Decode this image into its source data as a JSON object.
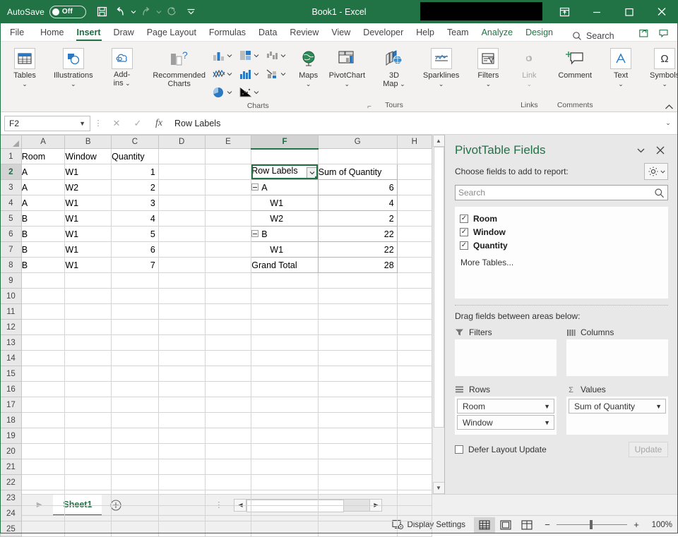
{
  "titlebar": {
    "autosave_label": "AutoSave",
    "autosave_state": "Off",
    "save_icon": "save-icon",
    "undo_icon": "undo-icon",
    "redo_icon": "redo-icon",
    "refresh_icon": "refresh-icon",
    "customize_icon": "customize-quick-access-toolbar-icon",
    "document_title": "Book1  -  Excel",
    "ribbon_display_icon": "ribbon-display-options-icon",
    "minimize_icon": "minimize-icon",
    "maximize_icon": "maximize-icon",
    "close_icon": "close-icon"
  },
  "ribbon_tabs": {
    "items": [
      {
        "label": "File",
        "state": "normal"
      },
      {
        "label": "Home",
        "state": "normal"
      },
      {
        "label": "Insert",
        "state": "active"
      },
      {
        "label": "Draw",
        "state": "normal"
      },
      {
        "label": "Page Layout",
        "state": "normal"
      },
      {
        "label": "Formulas",
        "state": "normal"
      },
      {
        "label": "Data",
        "state": "normal"
      },
      {
        "label": "Review",
        "state": "normal"
      },
      {
        "label": "View",
        "state": "normal"
      },
      {
        "label": "Developer",
        "state": "normal"
      },
      {
        "label": "Help",
        "state": "normal"
      },
      {
        "label": "Team",
        "state": "normal"
      },
      {
        "label": "Analyze",
        "state": "contextual"
      },
      {
        "label": "Design",
        "state": "contextual"
      }
    ],
    "search_label": "Search",
    "share_icon": "share-icon",
    "comments_icon": "comments-icon"
  },
  "ribbon": {
    "groups": [
      {
        "label": "",
        "buttons": [
          {
            "label": "Tables",
            "icon": "tables-icon",
            "chevron": true
          }
        ]
      },
      {
        "label": "",
        "buttons": [
          {
            "label": "Illustrations",
            "icon": "illustrations-icon",
            "chevron": true
          }
        ]
      },
      {
        "label": "",
        "buttons": [
          {
            "label": "Add-ins",
            "icon": "add-ins-icon",
            "chevron": true
          }
        ]
      },
      {
        "label": "Charts",
        "buttons": [
          {
            "label": "Recommended Charts",
            "icon": "recommended-charts-icon",
            "chevron": false
          }
        ]
      },
      {
        "label": "Tours",
        "buttons": [
          {
            "label": "3D Map",
            "icon": "3d-map-icon",
            "chevron": true
          }
        ]
      },
      {
        "label": "",
        "buttons": [
          {
            "label": "Sparklines",
            "icon": "sparklines-icon",
            "chevron": true
          }
        ]
      },
      {
        "label": "",
        "buttons": [
          {
            "label": "Filters",
            "icon": "filters-icon",
            "chevron": true
          }
        ]
      },
      {
        "label": "Links",
        "buttons": [
          {
            "label": "Link",
            "icon": "link-icon",
            "chevron": true
          }
        ]
      },
      {
        "label": "Comments",
        "buttons": [
          {
            "label": "Comment",
            "icon": "comment-icon",
            "chevron": false
          }
        ]
      },
      {
        "label": "",
        "buttons": [
          {
            "label": "Text",
            "icon": "text-icon",
            "chevron": true
          }
        ]
      },
      {
        "label": "",
        "buttons": [
          {
            "label": "Symbols",
            "icon": "symbols-icon",
            "chevron": true
          }
        ]
      }
    ],
    "maps_label": "Maps",
    "pivotchart_label": "PivotChart",
    "recommended_charts_label_l1": "Recommended",
    "recommended_charts_label_l2": "Charts",
    "map3d_label_l1": "3D",
    "map3d_label_l2": "Map",
    "sparklines_label": "Sparklines",
    "filters_label": "Filters",
    "link_label": "Link",
    "comment_label": "Comment",
    "text_label": "Text",
    "symbols_label": "Symbols",
    "tables_label": "Tables",
    "illustrations_label": "Illustrations",
    "addins_label_l1": "Add-",
    "addins_label_l2": "ins",
    "group_charts": "Charts",
    "group_tours": "Tours",
    "group_links": "Links",
    "group_comments": "Comments",
    "collapse_icon": "collapse-ribbon-icon"
  },
  "formula_bar": {
    "name_box_value": "F2",
    "cancel_icon": "cancel-icon",
    "enter_icon": "enter-icon",
    "function_icon": "insert-function-icon",
    "formula_value": "Row Labels",
    "expand_icon": "expand-formula-bar-icon"
  },
  "grid": {
    "columns": [
      "A",
      "B",
      "C",
      "D",
      "E",
      "F",
      "G",
      "H"
    ],
    "selected_column": "F",
    "selected_row": "2",
    "rows": [
      "1",
      "2",
      "3",
      "4",
      "5",
      "6",
      "7",
      "8",
      "9",
      "10",
      "11",
      "12",
      "13",
      "14",
      "15",
      "16",
      "17",
      "18",
      "19",
      "20",
      "21",
      "22",
      "23",
      "24",
      "25"
    ],
    "source_table": {
      "headers": [
        "Room",
        "Window",
        "Quantity"
      ],
      "rows": [
        [
          "A",
          "W1",
          "1"
        ],
        [
          "A",
          "W2",
          "2"
        ],
        [
          "A",
          "W1",
          "3"
        ],
        [
          "B",
          "W1",
          "4"
        ],
        [
          "B",
          "W1",
          "5"
        ],
        [
          "B",
          "W1",
          "6"
        ],
        [
          "B",
          "W1",
          "7"
        ]
      ]
    },
    "pivot_table": {
      "header_row_labels": "Row Labels",
      "header_values": "Sum of Quantity",
      "filter_icon": "filter-dropdown-icon",
      "rows": [
        {
          "label": "A",
          "value": "6",
          "level": 0,
          "expandable": true
        },
        {
          "label": "W1",
          "value": "4",
          "level": 1,
          "expandable": false
        },
        {
          "label": "W2",
          "value": "2",
          "level": 1,
          "expandable": false
        },
        {
          "label": "B",
          "value": "22",
          "level": 0,
          "expandable": true
        },
        {
          "label": "W1",
          "value": "22",
          "level": 1,
          "expandable": false
        },
        {
          "label": "Grand Total",
          "value": "28",
          "level": 0,
          "expandable": false
        }
      ]
    }
  },
  "pivot_pane": {
    "title": "PivotTable Fields",
    "dropdown_icon": "pane-options-icon",
    "close_icon": "close-pane-icon",
    "choose_fields_label": "Choose fields to add to report:",
    "gear_icon": "field-list-settings-icon",
    "search_placeholder": "Search",
    "search_icon": "search-icon",
    "fields": [
      {
        "name": "Room",
        "checked": true
      },
      {
        "name": "Window",
        "checked": true
      },
      {
        "name": "Quantity",
        "checked": true
      }
    ],
    "more_tables_label": "More Tables...",
    "drag_fields_label": "Drag fields between areas below:",
    "areas": [
      {
        "id": "filters",
        "label": "Filters",
        "icon": "filter-area-icon",
        "items": []
      },
      {
        "id": "columns",
        "label": "Columns",
        "icon": "columns-area-icon",
        "items": []
      },
      {
        "id": "rows",
        "label": "Rows",
        "icon": "rows-area-icon",
        "items": [
          "Room",
          "Window"
        ]
      },
      {
        "id": "values",
        "label": "Values",
        "icon": "sigma-values-area-icon",
        "items": [
          "Sum of Quantity"
        ]
      }
    ],
    "defer_label": "Defer Layout Update",
    "defer_checked": false,
    "update_label": "Update"
  },
  "sheet_tabs": {
    "prev_icon": "previous-sheet-icon",
    "next_icon": "next-sheet-icon",
    "tabs": [
      {
        "label": "Sheet1",
        "active": true
      }
    ],
    "add_sheet_icon": "add-sheet-icon"
  },
  "status_bar": {
    "accessibility_icon": "accessibility-checker-icon",
    "display_settings_label": "Display Settings",
    "display_settings_icon": "display-settings-icon",
    "views": [
      {
        "name": "normal-view",
        "active": true
      },
      {
        "name": "page-layout-view",
        "active": false
      },
      {
        "name": "page-break-preview-view",
        "active": false
      }
    ],
    "zoom_out_label": "−",
    "zoom_in_label": "+",
    "zoom_level": "100%"
  },
  "colors": {
    "excel_green": "#217346",
    "accent_blue": "#2b79c2",
    "ribbon_bg": "#f3f2f1",
    "pane_bg": "#e8e8e8"
  }
}
